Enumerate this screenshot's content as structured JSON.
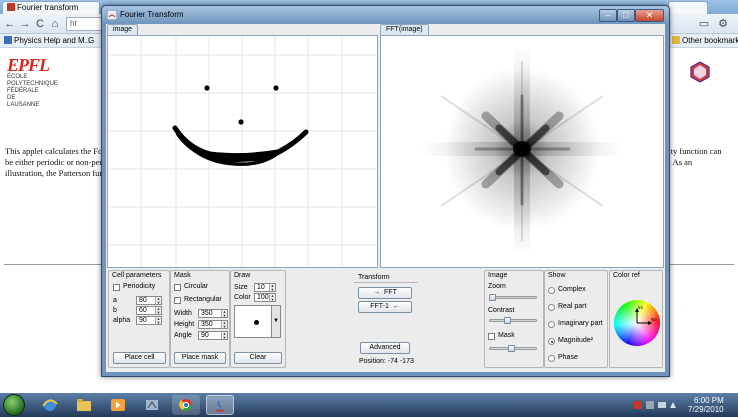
{
  "browser": {
    "tab_title": "Fourier transform",
    "tab_right_label": "",
    "url_partial": "ht",
    "bookmarks": [
      "Physics Help and M...",
      "G"
    ],
    "other_bookmarks": "Other bookmarks",
    "logo": {
      "mark": "EPFL",
      "line1": "ÉCOLE POLYTECHNIQUE",
      "line2": "FÉDÉRALE DE LAUSANNE"
    },
    "page_lines_left": [
      "This applet calculates the Fou",
      "be either periodic or non-peri",
      "illustration, the Patterson funct"
    ],
    "page_lines_right": [
      "sity function can",
      "a. As an"
    ]
  },
  "window": {
    "title": "Fourier Transform",
    "minimize_label": "–",
    "maximize_label": "□",
    "close_label": "✕"
  },
  "panes": {
    "image_tab": "image",
    "fft_tab": "FFT(image)"
  },
  "cell_parameters": {
    "title": "Cell parameters",
    "periodicity_label": "Periodicity",
    "periodicity_checked": false,
    "a_label": "a",
    "a_value": "80",
    "b_label": "b",
    "b_value": "60",
    "alpha_label": "alpha",
    "alpha_value": "90",
    "place_button": "Place cell"
  },
  "mask": {
    "title": "Mask",
    "circular_label": "Circular",
    "rectangular_label": "Rectangular",
    "width_label": "Width",
    "width_value": "350",
    "height_label": "Height",
    "height_value": "350",
    "angle_label": "Angle",
    "angle_value": "90",
    "place_button": "Place mask"
  },
  "draw": {
    "title": "Draw",
    "size_label": "Size",
    "size_value": "10",
    "color_label": "Color",
    "color_value": "100",
    "clear_button": "Clear"
  },
  "transform": {
    "title": "Transform",
    "fft_button": "FFT",
    "fft_arrow": "→",
    "ifft_button": "FFT-1",
    "ifft_arrow": "←",
    "advanced_button": "Advanced",
    "position_label": "Position: -74 -173"
  },
  "image_controls": {
    "title": "Image",
    "zoom_label": "Zoom",
    "zoom_level": 0.0,
    "contrast_label": "Contrast",
    "contrast_level": 0.4,
    "mask_label": "Mask",
    "mask_level": 0.5
  },
  "show": {
    "title": "Show",
    "options": [
      {
        "label": "Complex",
        "selected": false
      },
      {
        "label": "Real part",
        "selected": false
      },
      {
        "label": "Imaginary part",
        "selected": false
      },
      {
        "label": "Magnitude²",
        "selected": true
      },
      {
        "label": "Phase",
        "selected": false
      }
    ]
  },
  "color_ref": {
    "title": "Color ref",
    "axis_im": "Im",
    "axis_re": "Re"
  },
  "taskbar": {
    "clock_time": "6:00 PM",
    "clock_date": "7/29/2010"
  }
}
